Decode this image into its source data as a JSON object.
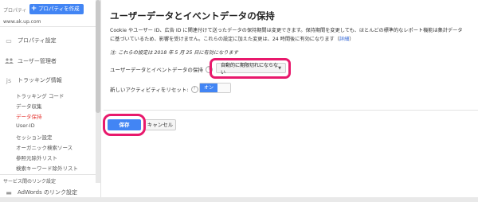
{
  "sidebar": {
    "property_label": "プロパティ",
    "create_button": "プロパティを作成",
    "site_url": "www.ak.up.com",
    "nav": [
      {
        "label": "プロパティ設定",
        "icon": "▭"
      },
      {
        "label": "ユーザー管理者",
        "icon": "👥"
      },
      {
        "label": "トラッキング情報",
        "icon": "js"
      }
    ],
    "tracking_items": [
      "トラッキング コード",
      "データ収集",
      "データ保持",
      "User-ID",
      "セッション設定",
      "オーガニック検索ソース",
      "参照元除外リスト",
      "検索キーワード除外リスト"
    ],
    "section_header": "サービス間のリンク設定",
    "adwords": "AdWords のリンク設定"
  },
  "main": {
    "title": "ユーザーデータとイベントデータの保持",
    "desc_line1": "Cookie やユーザー ID、広告 ID に関連付けて送ったデータの保持期間は変更できます。保持期間を変更しても、ほとんどの標準的なレポート機能は集計データ",
    "desc_line2_pre": "に基づいているため、影響を受けません。これらの設定に加えた変更は、24 時間後に有効になります（",
    "desc_link": "詳細",
    "desc_line2_post": "）",
    "note": "注: これらの設定は 2018 年 5 月 25 日に有効になります",
    "retention_label": "ユーザーデータとイベントデータの保持",
    "retention_value": "自動的に期限切れにならない",
    "reset_label": "新しいアクティビティをリセット:",
    "toggle_on": "オン",
    "save": "保存",
    "cancel": "キャンセル"
  },
  "colors": {
    "accent": "#4285f4",
    "highlight": "#e8196c",
    "active_nav": "#e53935"
  }
}
